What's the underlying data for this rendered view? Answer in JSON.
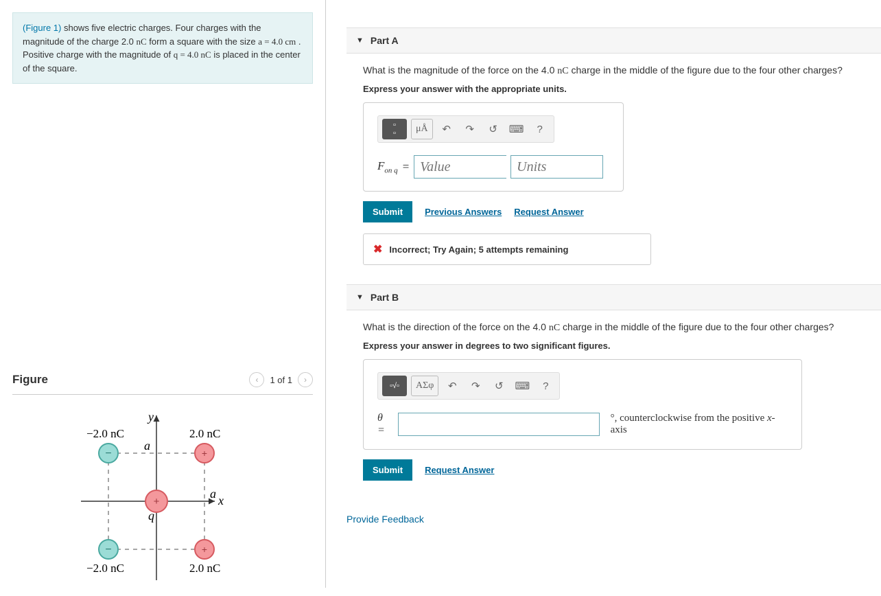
{
  "problem": {
    "figure_link": "(Figure 1)",
    "text1": " shows five electric charges. Four charges with the magnitude of the charge 2.0 ",
    "unit1": "nC",
    "text2": " form a square with the size ",
    "eq1": "a = 4.0 cm",
    "text3": " . Positive charge with the magnitude of ",
    "eq2": "q = 4.0 nC",
    "text4": " is placed in the center of the square."
  },
  "figure": {
    "title": "Figure",
    "nav": "1 of 1",
    "labels": {
      "y": "y",
      "x": "x",
      "q": "q",
      "a1": "a",
      "a2": "a",
      "tl": "−2.0 nC",
      "tr": "2.0 nC",
      "bl": "−2.0 nC",
      "br": "2.0 nC"
    }
  },
  "partA": {
    "title": "Part A",
    "question_pre": "What is the magnitude of the force on the 4.0 ",
    "question_unit": "nC",
    "question_post": " charge in the middle of the figure due to the four other charges?",
    "instruction": "Express your answer with the appropriate units.",
    "toolbar": {
      "fraction": "▫▫",
      "units": "μÅ",
      "help": "?"
    },
    "var_label_main": "F",
    "var_label_sub": "on q",
    "equals": " = ",
    "value_placeholder": "Value",
    "units_placeholder": "Units",
    "submit": "Submit",
    "prev_answers": "Previous Answers",
    "request_answer": "Request Answer",
    "feedback": "Incorrect; Try Again; 5 attempts remaining"
  },
  "partB": {
    "title": "Part B",
    "question_pre": "What is the direction of the force on the 4.0 ",
    "question_unit": "nC",
    "question_post": " charge in the middle of the figure due to the four other charges?",
    "instruction": "Express your answer in degrees to two significant figures.",
    "toolbar": {
      "template": "▫√▫",
      "greek": "ΑΣφ",
      "help": "?"
    },
    "var_label": "θ =",
    "suffix_deg": "°",
    "suffix_text1": ", counterclockwise from the positive ",
    "suffix_var": "x",
    "suffix_text2": "-axis",
    "submit": "Submit",
    "request_answer": "Request Answer"
  },
  "provide_feedback": "Provide Feedback"
}
